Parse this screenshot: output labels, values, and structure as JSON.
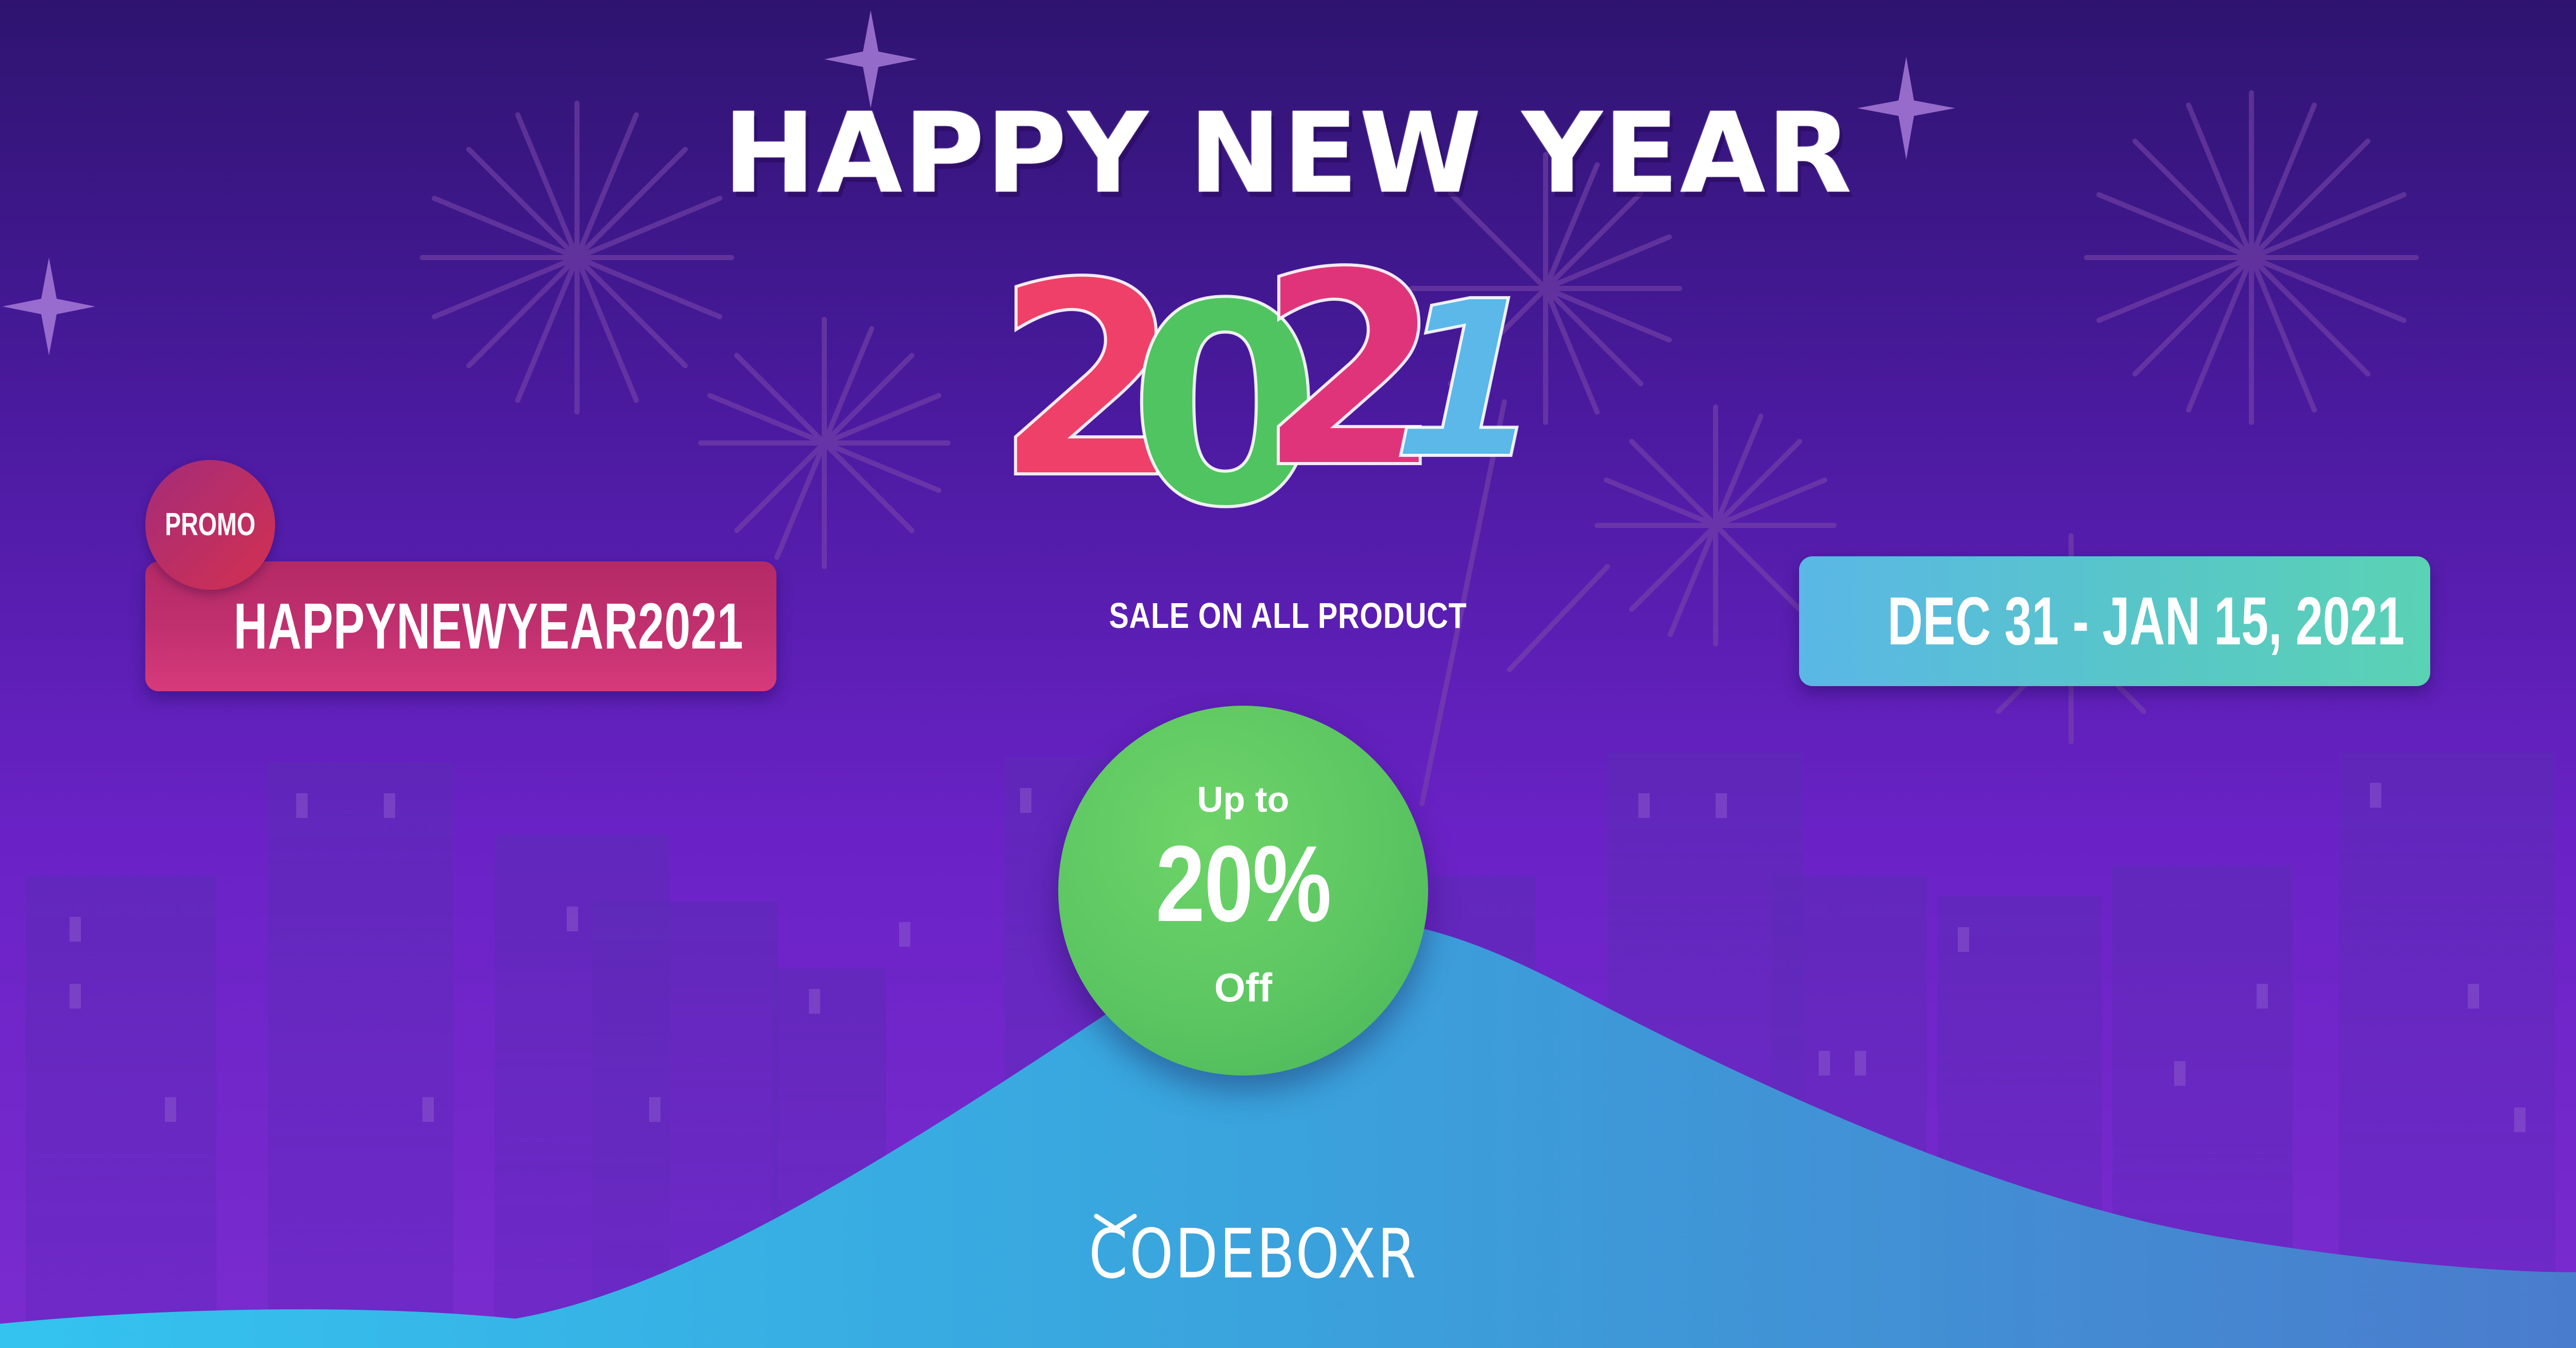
{
  "banner": {
    "headline": "HAPPY NEW YEAR",
    "year_digits": [
      "2",
      "0",
      "2",
      "1"
    ],
    "tagline": "SALE ON ALL PRODUCT",
    "promo": {
      "label": "PROMO",
      "code": "HAPPYNEWYEAR2021"
    },
    "date_range": "DEC 31 - JAN 15, 2021",
    "discount": {
      "prefix": "Up to",
      "value": "20%",
      "suffix": "Off"
    },
    "brand": "CODEBOXR"
  },
  "colors": {
    "background_top": "#2e1470",
    "background_bottom": "#7a2ccf",
    "promo_pill": "#c0306e",
    "date_pill": "#58c6c8",
    "discount_circle": "#5cc662",
    "wave": "#3aa2dc",
    "digit_2_first": "#ee4068",
    "digit_0": "#4fc460",
    "digit_2_second": "#e0347a",
    "digit_1": "#5bb8e8"
  },
  "icons": [
    "sparkle-star-icon",
    "firework-burst-icon",
    "codeboxr-logo-mark-icon"
  ]
}
